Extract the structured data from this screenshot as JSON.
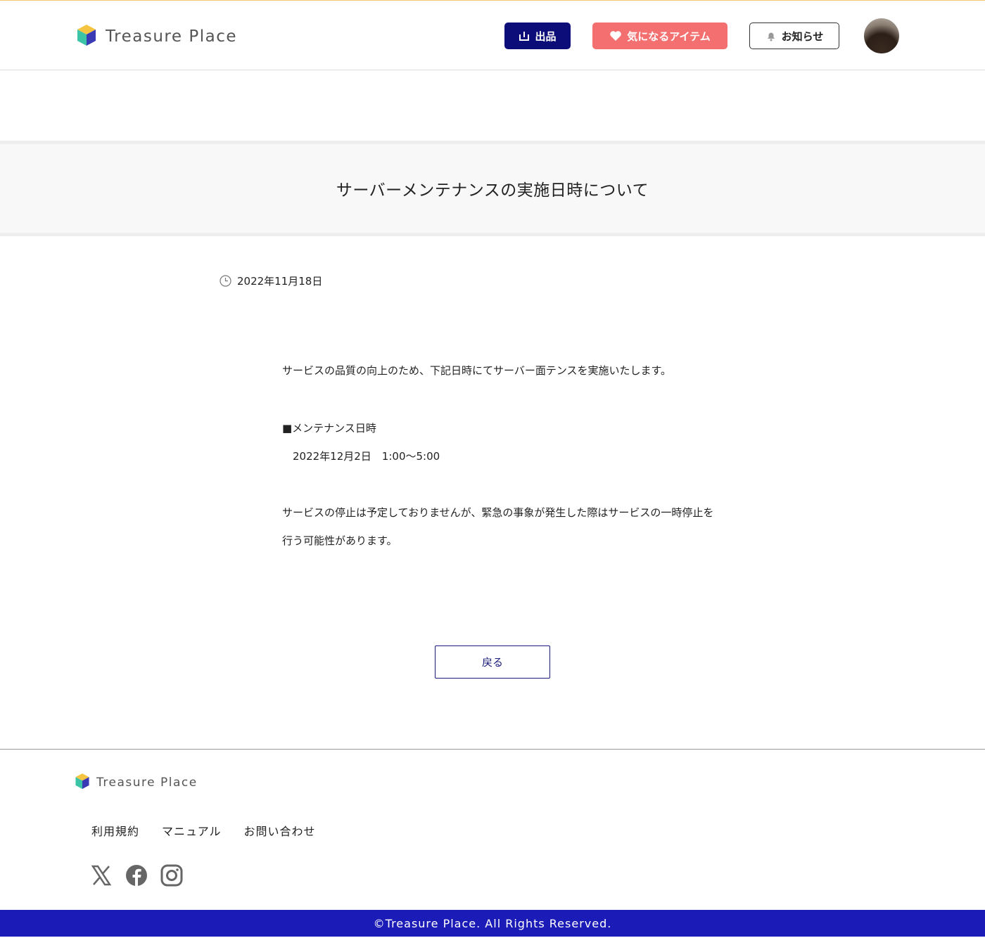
{
  "header": {
    "brand": "Treasure Place",
    "listing_label": "出品",
    "favorites_label": "気になるアイテム",
    "notifications_label": "お知らせ"
  },
  "notice": {
    "title": "サーバーメンテナンスの実施日時について",
    "date": "2022年11月18日",
    "body": [
      "サービスの品質の向上のため、下記日時にてサーバー面テンスを実施いたします。",
      "■メンテナンス日時",
      "　2022年12月2日　1:00〜5:00",
      "サービスの停止は予定しておりませんが、緊急の事象が発生した際はサービスの一時停止を",
      "行う可能性があります。"
    ],
    "back_label": "戻る"
  },
  "footer": {
    "brand": "Treasure Place",
    "links": [
      "利用規約",
      "マニュアル",
      "お問い合わせ"
    ],
    "social": [
      "x-icon",
      "facebook-icon",
      "instagram-icon"
    ],
    "copyright": "©Treasure Place. All Rights Reserved."
  },
  "colors": {
    "primary": "#0d0d7a",
    "favorite": "#f46f6f",
    "footer_bar": "#1b1bb8",
    "header_top_line": "#f2c86c"
  }
}
